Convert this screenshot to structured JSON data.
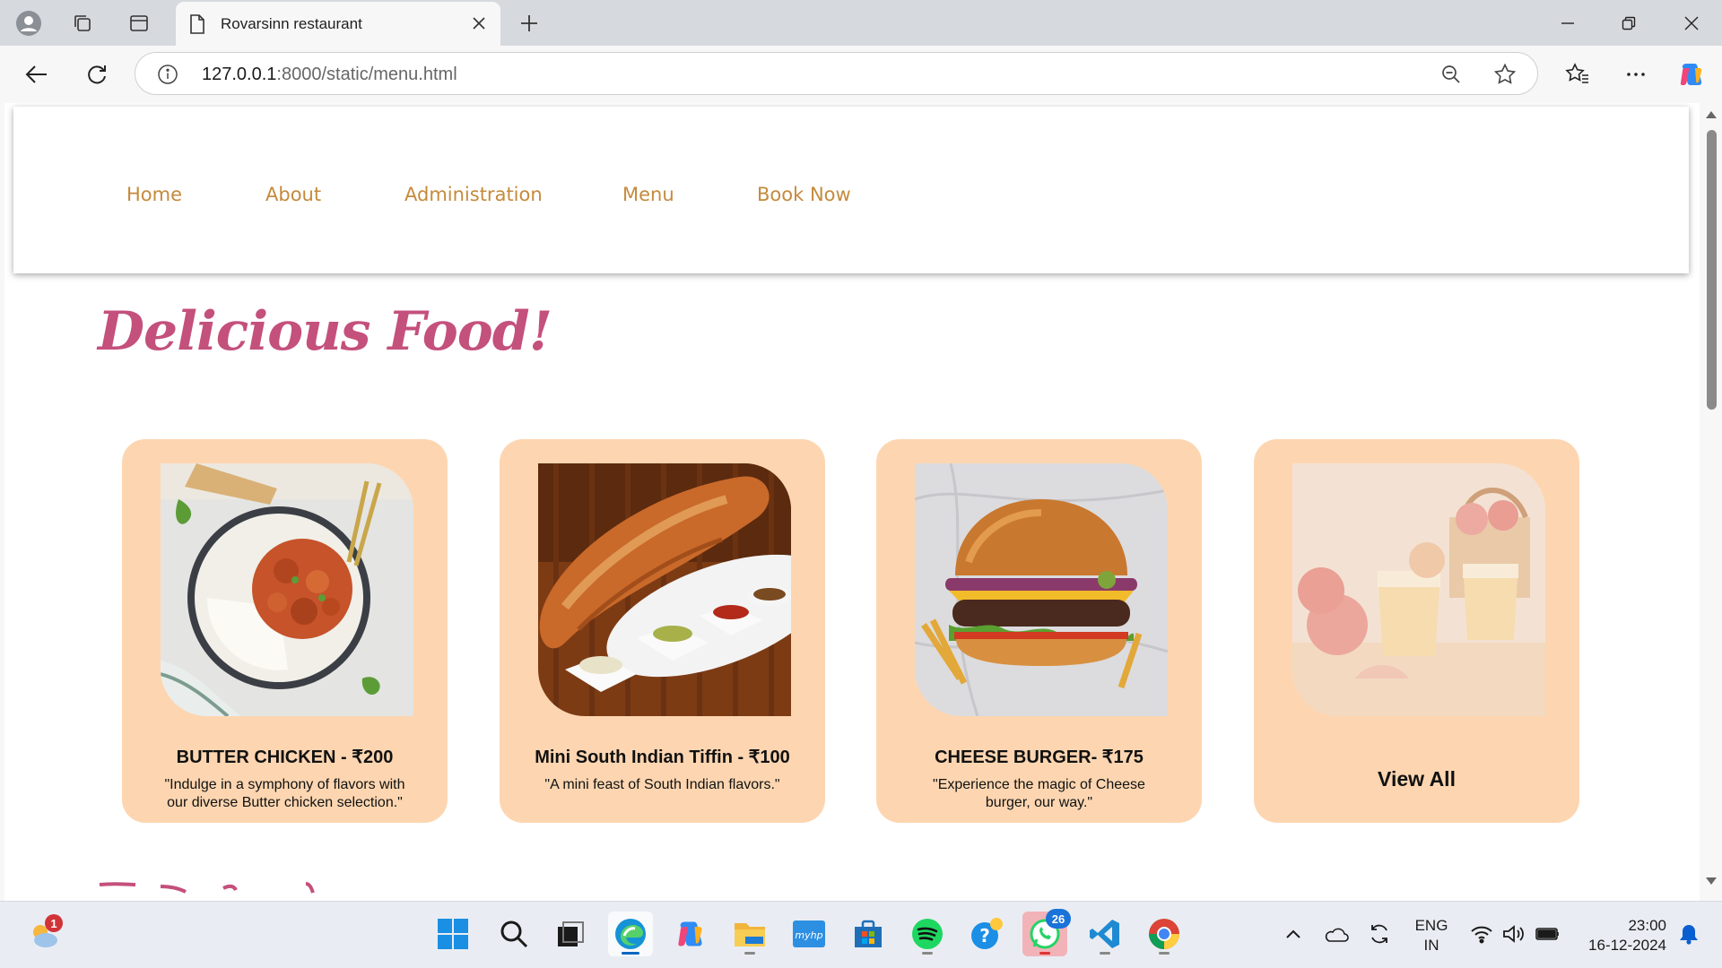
{
  "browser": {
    "tab_title": "Rovarsinn restaurant",
    "url_host": "127.0.0.1",
    "url_rest": ":8000/static/menu.html"
  },
  "nav": {
    "items": [
      "Home",
      "About",
      "Administration",
      "Menu",
      "Book Now"
    ],
    "link_color": "#c58a3c"
  },
  "page": {
    "title": "Delicious Food!",
    "title_color": "#c4507c",
    "card_color": "#fdd6b1"
  },
  "cards": [
    {
      "name": "BUTTER CHICKEN - ₹200",
      "desc": "\"Indulge in a symphony of flavors with our diverse Butter chicken selection.\"",
      "image": "butter-chicken-image"
    },
    {
      "name": "Mini South Indian Tiffin - ₹100",
      "desc": "\"A mini feast of South Indian flavors.\"",
      "image": "dosa-tiffin-image"
    },
    {
      "name": "CHEESE BURGER- ₹175",
      "desc": "\"Experience the magic of Cheese burger, our way.\"",
      "image": "cheese-burger-image"
    },
    {
      "label": "View All",
      "image": "apple-juice-image"
    }
  ],
  "taskbar": {
    "weather_badge": "1",
    "whatsapp_badge": "26",
    "lang_line1": "ENG",
    "lang_line2": "IN",
    "time": "23:00",
    "date": "16-12-2024"
  }
}
